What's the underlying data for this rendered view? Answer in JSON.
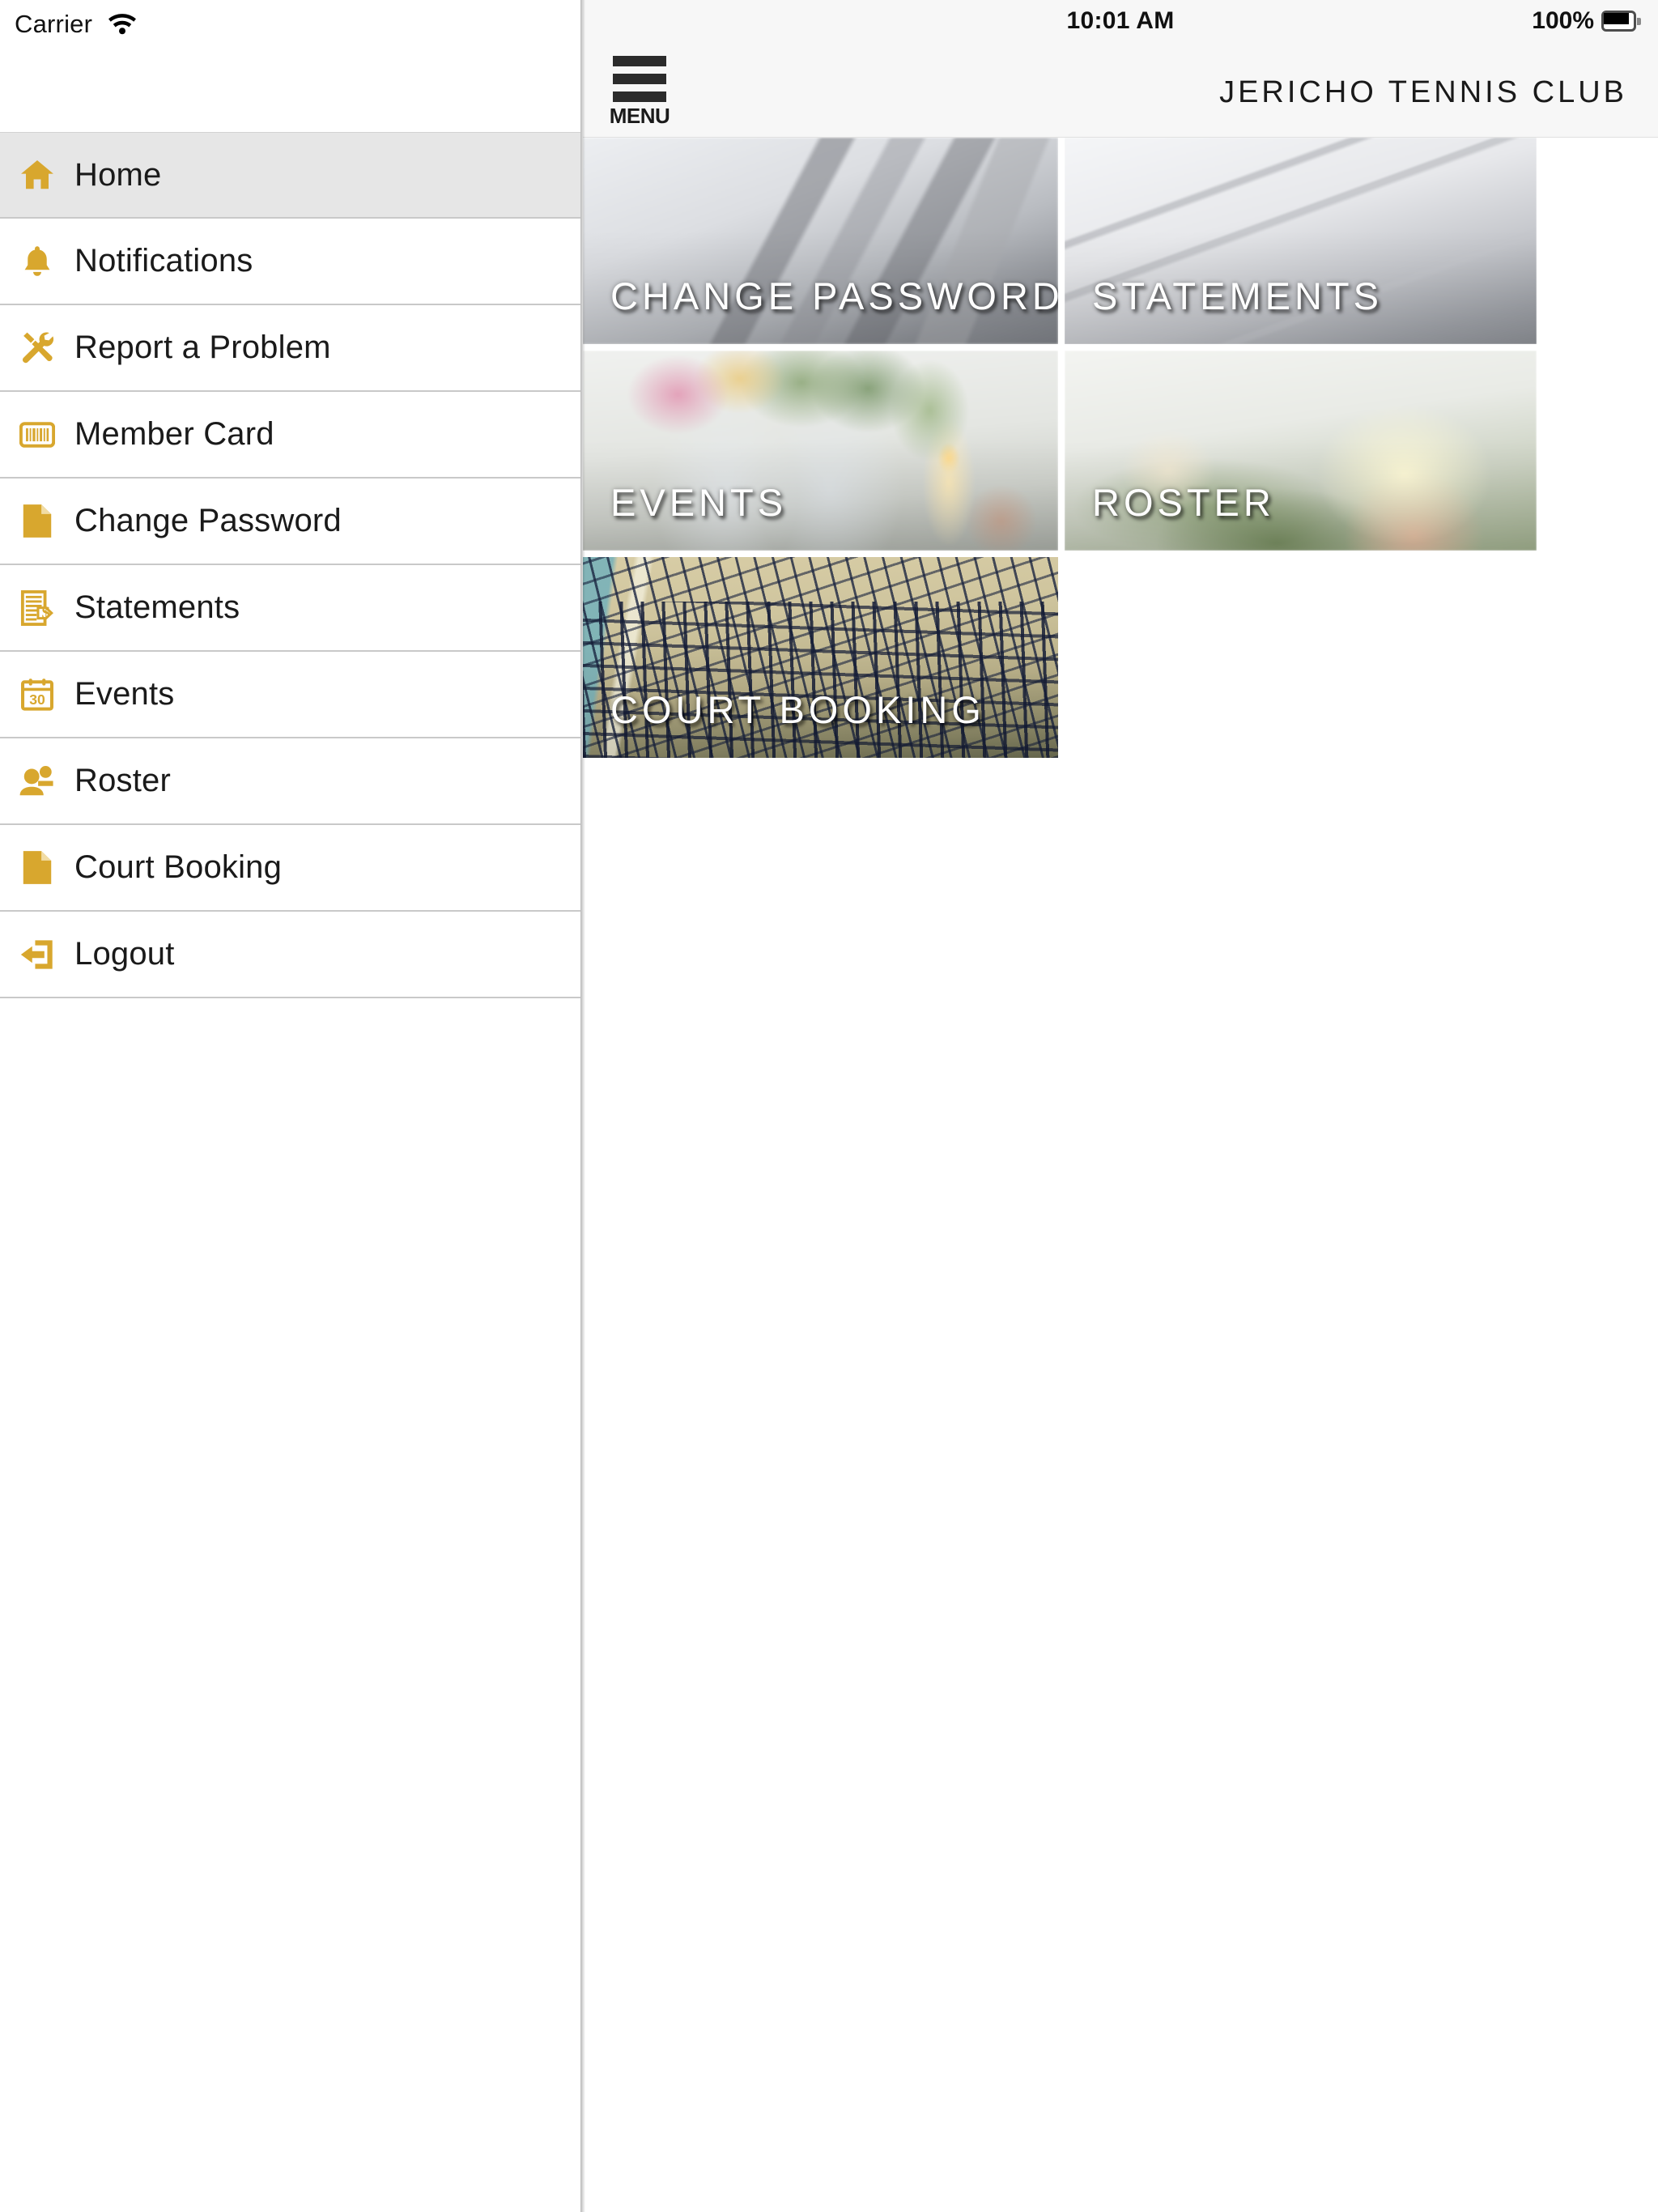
{
  "theme": {
    "accent": "#D8A72E",
    "sidebar_active_bg": "#E6E6E6",
    "navbar_bg": "#F7F7F7",
    "divider": "#C9C9C9",
    "text": "#1A1A1A"
  },
  "sidebar": {
    "status": {
      "carrier": "Carrier",
      "wifi_icon": "wifi-icon"
    },
    "items": [
      {
        "label": "Home",
        "icon": "home-icon",
        "active": true
      },
      {
        "label": "Notifications",
        "icon": "bell-icon",
        "active": false
      },
      {
        "label": "Report a Problem",
        "icon": "tools-icon",
        "active": false
      },
      {
        "label": "Member Card",
        "icon": "barcode-icon",
        "active": false
      },
      {
        "label": "Change Password",
        "icon": "document-icon",
        "active": false
      },
      {
        "label": "Statements",
        "icon": "document-money-icon",
        "active": false
      },
      {
        "label": "Events",
        "icon": "calendar-30-icon",
        "active": false
      },
      {
        "label": "Roster",
        "icon": "people-icon",
        "active": false
      },
      {
        "label": "Court Booking",
        "icon": "document-icon",
        "active": false
      },
      {
        "label": "Logout",
        "icon": "logout-arrow-icon",
        "active": false
      }
    ]
  },
  "content": {
    "status": {
      "time": "10:01 AM",
      "battery_percent": "100%",
      "battery_icon": "battery-full-icon"
    },
    "navbar": {
      "menu_label": "MENU",
      "menu_icon": "hamburger-icon",
      "title": "JERICHO TENNIS CLUB"
    },
    "tiles": [
      {
        "label": "CHANGE PASSWORD",
        "art": "img-papers",
        "name": "tile-change-password"
      },
      {
        "label": "STATEMENTS",
        "art": "img-statement",
        "name": "tile-statements"
      },
      {
        "label": "EVENTS",
        "art": "img-events",
        "name": "tile-events"
      },
      {
        "label": "ROSTER",
        "art": "img-roster",
        "name": "tile-roster"
      },
      {
        "label": "COURT BOOKING",
        "art": "img-court",
        "name": "tile-court-booking"
      }
    ]
  }
}
